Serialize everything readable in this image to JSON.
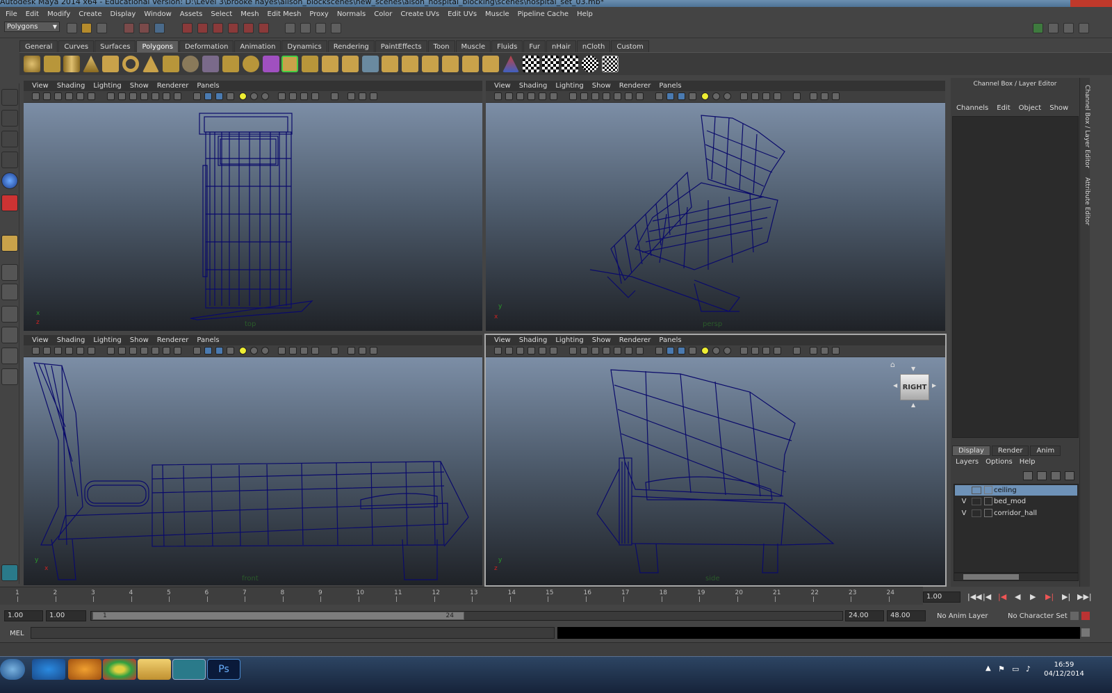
{
  "window": {
    "title": "Autodesk Maya 2014 x64 - Educational Version: D:\\Level 3\\brooke hayes\\alison_blockscenes\\new_scenes\\aison_hospital_blocking\\scenes\\hospital_set_03.mb*"
  },
  "menubar": [
    "File",
    "Edit",
    "Modify",
    "Create",
    "Display",
    "Window",
    "Assets",
    "Select",
    "Mesh",
    "Edit Mesh",
    "Proxy",
    "Normals",
    "Color",
    "Create UVs",
    "Edit UVs",
    "Muscle",
    "Pipeline Cache",
    "Help"
  ],
  "status_line": {
    "menu_set": "Polygons"
  },
  "shelf": {
    "tabs": [
      "General",
      "Curves",
      "Surfaces",
      "Polygons",
      "Deformation",
      "Animation",
      "Dynamics",
      "Rendering",
      "PaintEffects",
      "Toon",
      "Muscle",
      "Fluids",
      "Fur",
      "nHair",
      "nCloth",
      "Custom"
    ],
    "active": "Polygons"
  },
  "panel_menu": [
    "View",
    "Shading",
    "Lighting",
    "Show",
    "Renderer",
    "Panels"
  ],
  "viewports": {
    "top": {
      "camera": "top"
    },
    "persp": {
      "camera": "persp"
    },
    "front": {
      "camera": "front"
    },
    "side": {
      "camera": "side",
      "viewcube": "RIGHT"
    }
  },
  "channel_box": {
    "title": "Channel Box / Layer Editor",
    "menu": [
      "Channels",
      "Edit",
      "Object",
      "Show"
    ]
  },
  "layer_editor": {
    "tabs": [
      "Display",
      "Render",
      "Anim"
    ],
    "active_tab": "Display",
    "menu": [
      "Layers",
      "Options",
      "Help"
    ],
    "layers": [
      {
        "v": "",
        "name": "ceiling",
        "selected": true
      },
      {
        "v": "V",
        "name": "bed_mod",
        "selected": false
      },
      {
        "v": "V",
        "name": "corridor_hall",
        "selected": false
      }
    ]
  },
  "side_tabs": [
    "Channel Box / Layer Editor",
    "Attribute Editor"
  ],
  "time_slider": {
    "ticks": [
      "1",
      "2",
      "3",
      "4",
      "5",
      "6",
      "7",
      "8",
      "9",
      "10",
      "11",
      "12",
      "13",
      "14",
      "15",
      "16",
      "17",
      "18",
      "19",
      "20",
      "21",
      "22",
      "23",
      "24"
    ],
    "current_time": "1.00"
  },
  "range_slider": {
    "start_time": "1.00",
    "playback_start": "1.00",
    "range_start_label": "1",
    "range_end_label": "24",
    "playback_end": "24.00",
    "end_time": "48.00",
    "anim_layer": "No Anim Layer",
    "character_set": "No Character Set"
  },
  "command_line": {
    "label": "MEL"
  },
  "taskbar": {
    "time": "16:59",
    "date": "04/12/2014"
  }
}
